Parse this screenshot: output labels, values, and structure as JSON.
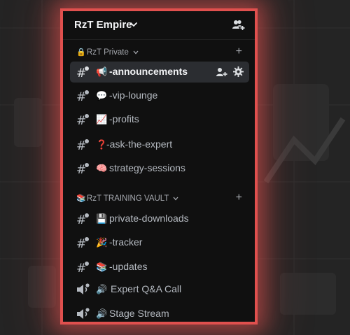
{
  "server": {
    "name": "RzT Empire"
  },
  "categories": [
    {
      "emoji": "🔒",
      "label": "RzT Private"
    },
    {
      "emoji": "📚",
      "label": "RzT TRAINING VAULT"
    }
  ],
  "channels": [
    {
      "type": "text",
      "emoji": "📢",
      "name": "-announcements",
      "active": true
    },
    {
      "type": "text",
      "emoji": "💬",
      "name": "-vip-lounge"
    },
    {
      "type": "text",
      "emoji": "📈",
      "name": "-profits"
    },
    {
      "type": "text",
      "emoji": "❓",
      "name": "-ask-the-expert"
    },
    {
      "type": "text",
      "emoji": "🧠",
      "name": "strategy-sessions"
    },
    {
      "type": "text",
      "emoji": "💾",
      "name": "private-downloads"
    },
    {
      "type": "text",
      "emoji": "🎉",
      "name": "-tracker"
    },
    {
      "type": "text",
      "emoji": "📚",
      "name": "-updates"
    },
    {
      "type": "voice",
      "emoji": "🔊",
      "name": "Expert Q&A Call"
    },
    {
      "type": "voice",
      "emoji": "🔊",
      "name": "Stage Stream"
    }
  ],
  "colors": {
    "frame_border": "#e0504e",
    "sidebar_bg": "#101010",
    "active_row_bg": "#2b2d31",
    "channel_text": "#b5bac1"
  }
}
